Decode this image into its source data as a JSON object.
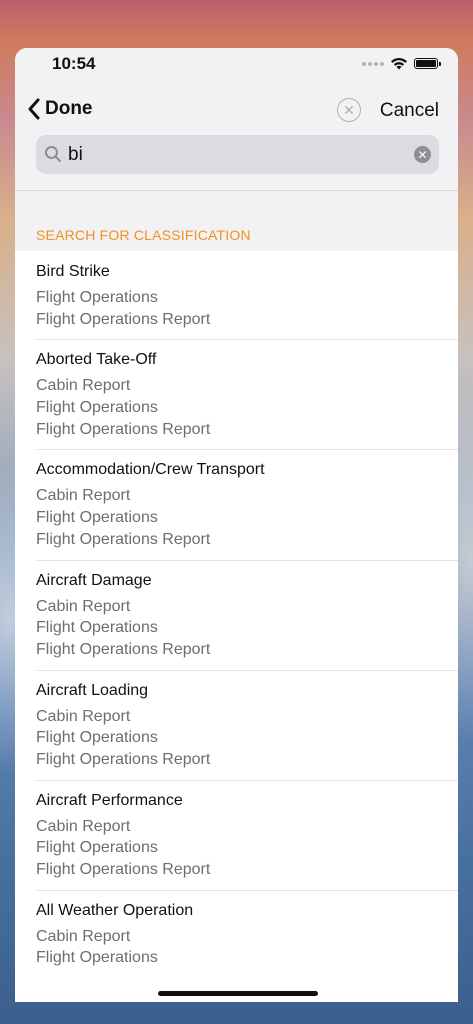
{
  "status_bar": {
    "time": "10:54"
  },
  "nav": {
    "done_label": "Done",
    "cancel_label": "Cancel"
  },
  "search": {
    "value": "bi",
    "placeholder": ""
  },
  "section": {
    "header": "SEARCH FOR CLASSIFICATION"
  },
  "results": [
    {
      "title": "Bird Strike",
      "subtitles": [
        "Flight Operations",
        "Flight Operations Report"
      ]
    },
    {
      "title": "Aborted Take-Off",
      "subtitles": [
        "Cabin Report",
        "Flight Operations",
        "Flight Operations Report"
      ]
    },
    {
      "title": "Accommodation/Crew Transport",
      "subtitles": [
        "Cabin Report",
        "Flight Operations",
        "Flight Operations Report"
      ]
    },
    {
      "title": "Aircraft Damage",
      "subtitles": [
        "Cabin Report",
        "Flight Operations",
        "Flight Operations Report"
      ]
    },
    {
      "title": "Aircraft Loading",
      "subtitles": [
        "Cabin Report",
        "Flight Operations",
        "Flight Operations Report"
      ]
    },
    {
      "title": "Aircraft Performance",
      "subtitles": [
        "Cabin Report",
        "Flight Operations",
        "Flight Operations Report"
      ]
    },
    {
      "title": "All Weather Operation",
      "subtitles": [
        "Cabin Report",
        "Flight Operations"
      ]
    }
  ],
  "icons": {
    "back": "chevron-left-icon",
    "clear_circle": "clear-circle-icon",
    "search": "search-icon",
    "search_clear": "clear-icon",
    "wifi": "wifi-icon",
    "battery": "battery-icon",
    "signal": "signal-dots-icon"
  },
  "colors": {
    "section_header": "#f0911e",
    "subtitle": "#6d6d72",
    "header_bg": "#f2f2f4"
  }
}
